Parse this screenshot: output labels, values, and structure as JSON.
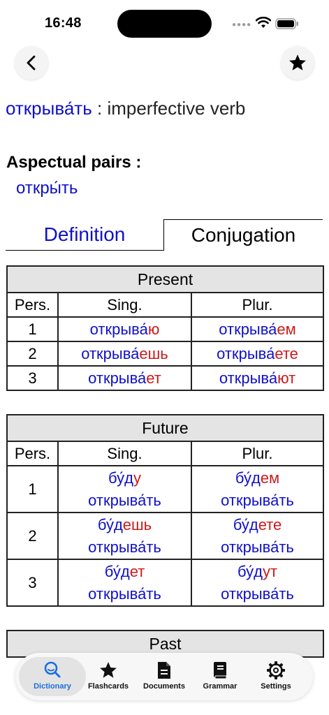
{
  "status_bar": {
    "time": "16:48"
  },
  "entry": {
    "headword": "открыва́ть",
    "separator": " : ",
    "part_of_speech": "imperfective verb",
    "aspect_heading": "Aspectual pairs :",
    "aspect_pair": "откры́ть"
  },
  "tabs": {
    "definition": "Definition",
    "conjugation": "Conjugation"
  },
  "present": {
    "title": "Present",
    "col_person": "Pers.",
    "col_sing": "Sing.",
    "col_plur": "Plur.",
    "rows": [
      {
        "person": "1",
        "sing_stem": "открыва́",
        "sing_end": "ю",
        "plur_stem": "открыва́",
        "plur_end": "ем"
      },
      {
        "person": "2",
        "sing_stem": "открыва́",
        "sing_end": "ешь",
        "plur_stem": "открыва́",
        "plur_end": "ете"
      },
      {
        "person": "3",
        "sing_stem": "открыва́",
        "sing_end": "ет",
        "plur_stem": "открыва́",
        "plur_end": "ют"
      }
    ]
  },
  "future": {
    "title": "Future",
    "col_person": "Pers.",
    "col_sing": "Sing.",
    "col_plur": "Plur.",
    "infinitive": "открыва́ть",
    "rows": [
      {
        "person": "1",
        "sing_stem": "бу́д",
        "sing_end": "у",
        "plur_stem": "бу́д",
        "plur_end": "ем"
      },
      {
        "person": "2",
        "sing_stem": "бу́д",
        "sing_end": "ешь",
        "plur_stem": "бу́д",
        "plur_end": "ете"
      },
      {
        "person": "3",
        "sing_stem": "бу́д",
        "sing_end": "ет",
        "plur_stem": "бу́д",
        "plur_end": "ут"
      }
    ]
  },
  "past": {
    "title": "Past"
  },
  "tabbar": {
    "items": [
      {
        "label": "Dictionary",
        "icon": "magnifier-icon"
      },
      {
        "label": "Flashcards",
        "icon": "star-icon"
      },
      {
        "label": "Documents",
        "icon": "document-icon"
      },
      {
        "label": "Grammar",
        "icon": "book-icon"
      },
      {
        "label": "Settings",
        "icon": "gear-icon"
      }
    ],
    "active_color": "#1a6fe0"
  },
  "colors": {
    "word": "#1010c8",
    "ending": "#cc1a1a",
    "header_bg": "#e4e4e4"
  }
}
